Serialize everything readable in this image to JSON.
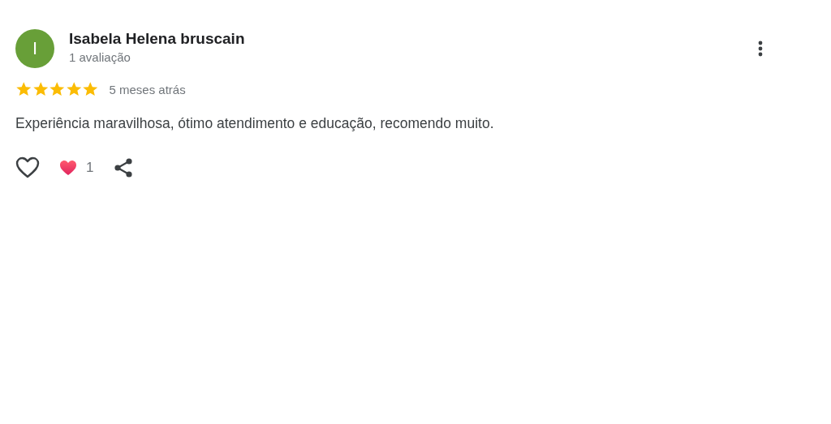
{
  "review": {
    "avatar_letter": "I",
    "author": "Isabela Helena bruscain",
    "author_meta": "1 avaliação",
    "stars": 5,
    "time": "5 meses atrás",
    "text": "Experiência maravilhosa, ótimo atendimento e educação, recomendo muito.",
    "reaction_count": "1"
  }
}
